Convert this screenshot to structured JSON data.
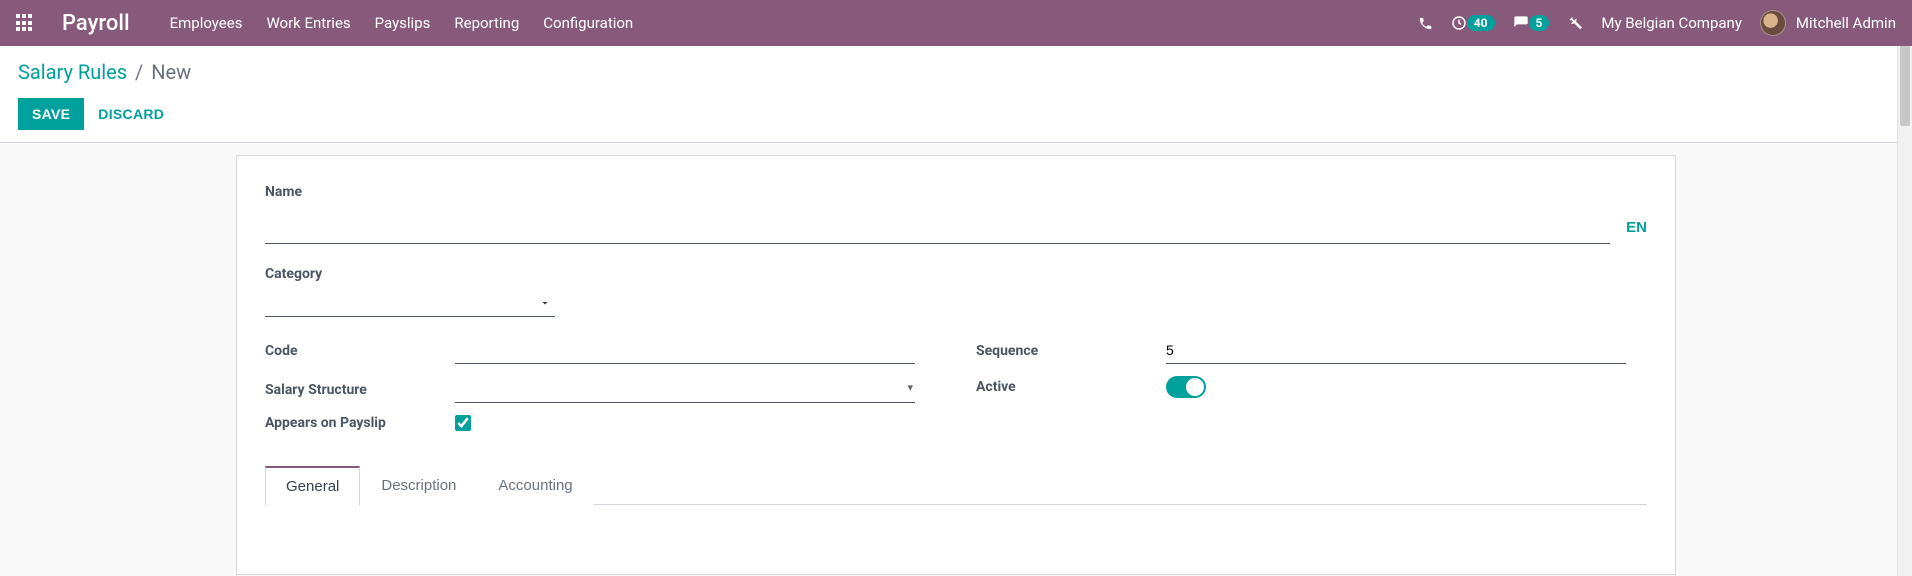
{
  "header": {
    "brand": "Payroll",
    "nav": [
      "Employees",
      "Work Entries",
      "Payslips",
      "Reporting",
      "Configuration"
    ],
    "activity_count": "40",
    "message_count": "5",
    "company": "My Belgian Company",
    "user": "Mitchell Admin"
  },
  "breadcrumb": {
    "root": "Salary Rules",
    "sep": "/",
    "current": "New"
  },
  "actions": {
    "save": "SAVE",
    "discard": "DISCARD"
  },
  "form": {
    "name_label": "Name",
    "name_value": "",
    "lang": "EN",
    "category_label": "Category",
    "category_value": "",
    "code_label": "Code",
    "code_value": "",
    "structure_label": "Salary Structure",
    "structure_value": "",
    "appears_label": "Appears on Payslip",
    "appears_checked": true,
    "sequence_label": "Sequence",
    "sequence_value": "5",
    "active_label": "Active",
    "active_on": true
  },
  "tabs": [
    "General",
    "Description",
    "Accounting"
  ]
}
